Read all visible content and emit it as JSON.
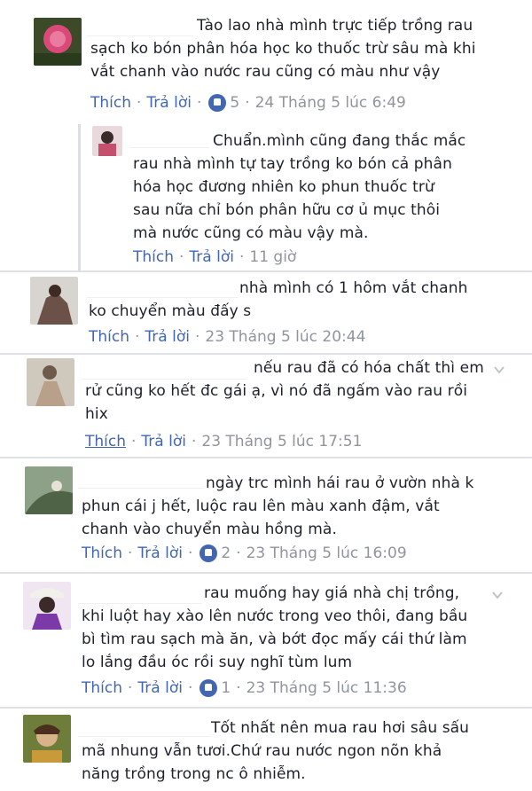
{
  "comments": [
    {
      "text": "Tào lao nhà mình trực tiếp trồng rau\nsạch ko bón phân hóa học ko thuốc trừ sâu mà khi\nvắt chanh vào nước rau cũng có màu như vậy",
      "like_label": "Thích",
      "reply_label": "Trả lời",
      "reaction_count": "5",
      "time": "24 Tháng 5 lúc 6:49"
    },
    {
      "text": "Chuẩn.mình cũng đang thắc mắc\nrau nhà mình tự tay trồng ko bón cả phân\nhóa học đương nhiên ko phun thuốc trừ\nsau nữa chỉ bón phân hữu cơ ủ mục thôi\nmà nước cũng có màu vậy mà.",
      "like_label": "Thích",
      "reply_label": "Trả lời",
      "time": "11 giờ"
    },
    {
      "text": "nhà mình có 1 hôm vắt chanh\nko chuyển màu đấy s",
      "like_label": "Thích",
      "reply_label": "Trả lời",
      "time": "23 Tháng 5 lúc 20:44"
    },
    {
      "text": "nếu rau đã có hóa chất thì em\nrử cũng ko hết đc gái ạ, vì nó đã ngấm vào rau rồi\nhix",
      "like_label": "Thích",
      "reply_label": "Trả lời",
      "time": "23 Tháng 5 lúc 17:51"
    },
    {
      "text": "ngày trc mình hái rau ở vườn nhà k\nphun cái j hết, luộc rau lên màu xanh đậm, vắt\nchanh vào chuyển màu hồng mà.",
      "like_label": "Thích",
      "reply_label": "Trả lời",
      "reaction_count": "2",
      "time": "23 Tháng 5 lúc 16:09"
    },
    {
      "text": "rau muống hay giá nhà chị trồng,\nkhi luột hay xào lên nước trong veo thôi, đang bầu\nbì tìm rau sạch mà ăn, và bớt đọc mấy cái thứ làm\nlo lắng đầu óc rồi suy nghĩ tùm lum",
      "like_label": "Thích",
      "reply_label": "Trả lời",
      "reaction_count": "1",
      "time": "23 Tháng 5 lúc 11:36"
    },
    {
      "text": "Tốt nhất nên mua rau hơi sâu sấu\nmã nhung vẫn tươi.Chứ rau nước ngon nõn khả\nnăng trồng trong nc ô nhiễm."
    }
  ],
  "icons": {
    "like": "like-thumb-icon",
    "options": "chevron-down-icon"
  },
  "colors": {
    "link": "#4267b2",
    "meta": "#90949c",
    "text": "#1d2129"
  }
}
